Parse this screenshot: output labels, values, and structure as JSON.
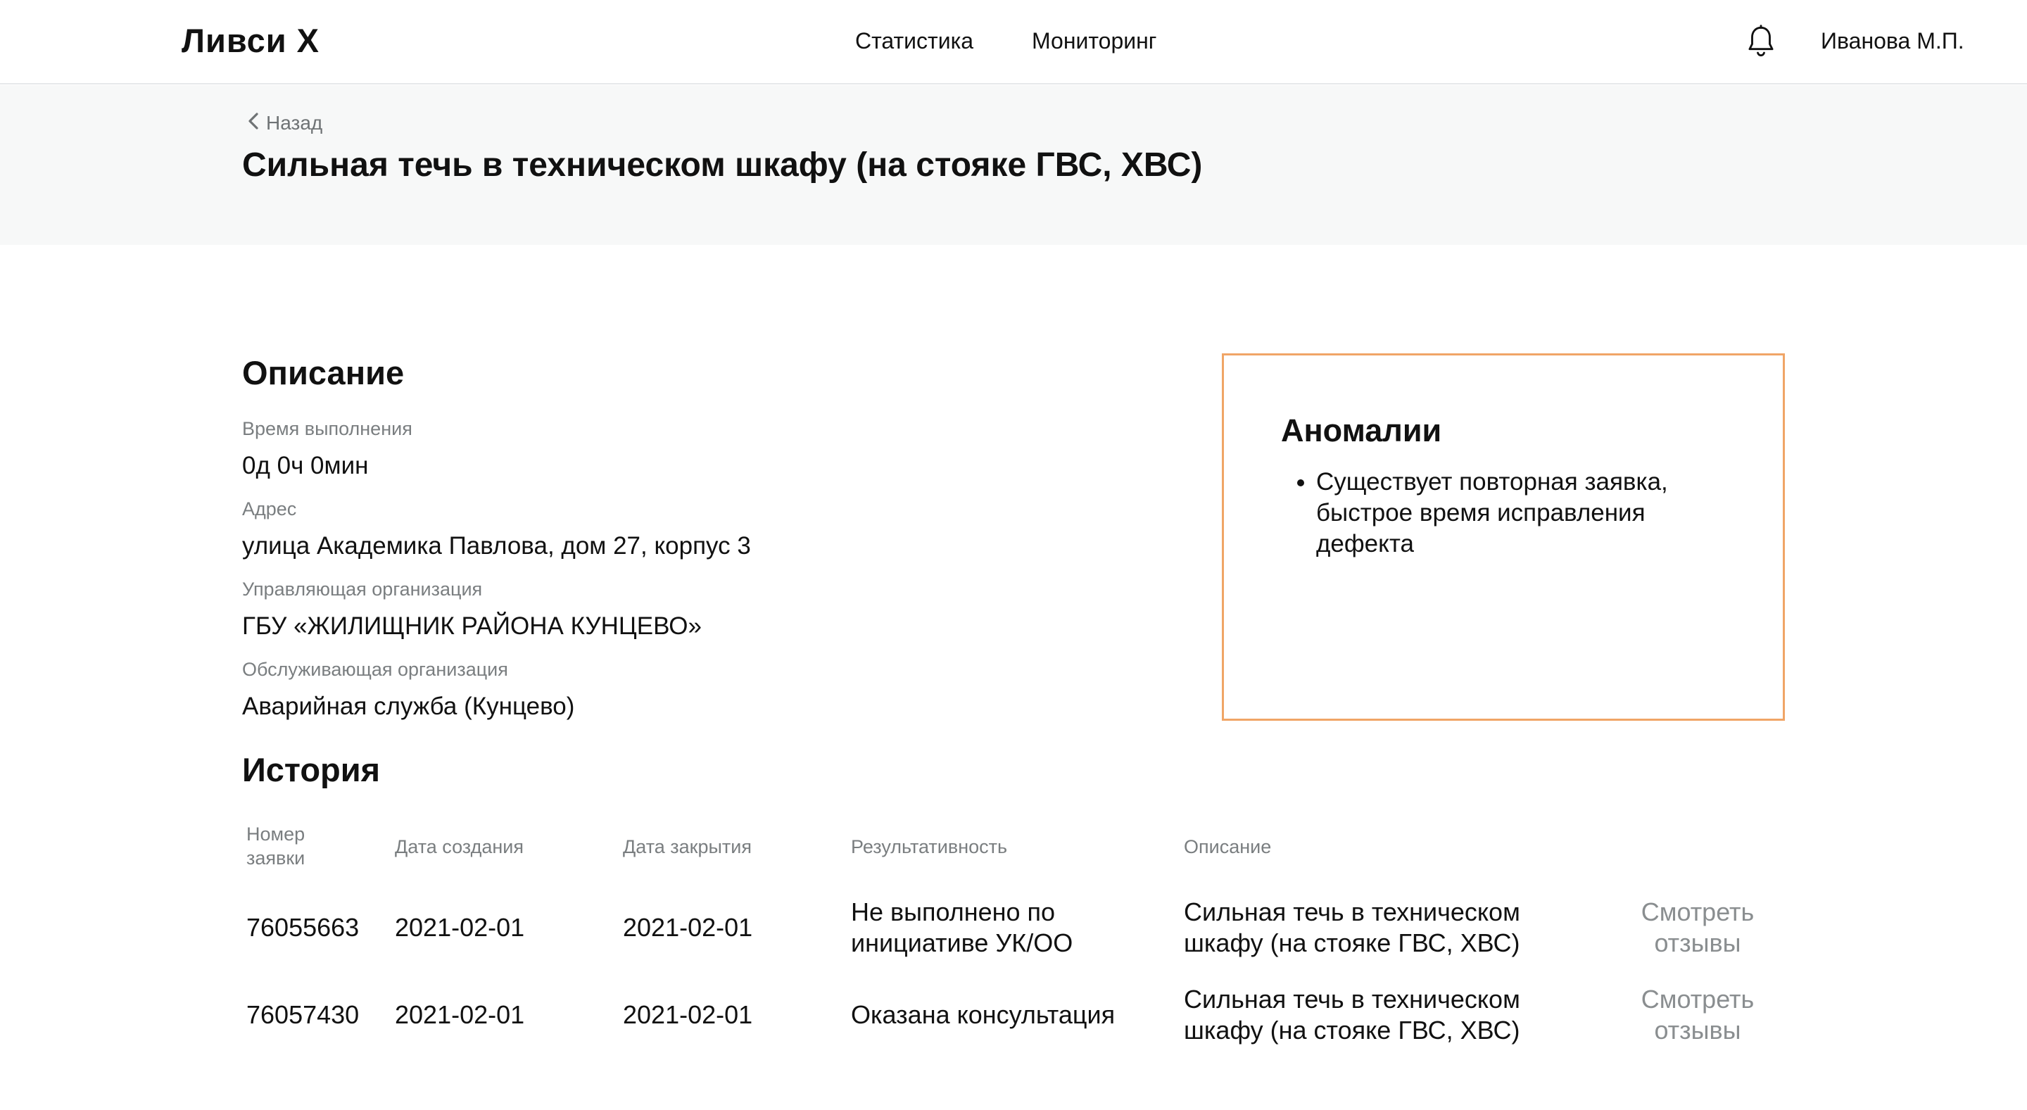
{
  "header": {
    "logo": "Ливси X",
    "nav": [
      "Статистика",
      "Мониторинг"
    ],
    "user": "Иванова М.П."
  },
  "page": {
    "back_label": "Назад",
    "title": "Сильная течь в техническом шкафу (на стояке ГВС, ХВС)"
  },
  "description": {
    "title": "Описание",
    "fields": [
      {
        "label": "Время выполнения",
        "value": "0д 0ч 0мин"
      },
      {
        "label": "Адрес",
        "value": "улица Академика Павлова, дом 27, корпус 3"
      },
      {
        "label": "Управляющая организация",
        "value": "ГБУ «ЖИЛИЩНИК РАЙОНА КУНЦЕВО»"
      },
      {
        "label": "Обслуживающая организация",
        "value": "Аварийная служба (Кунцево)"
      }
    ]
  },
  "anomalies": {
    "title": "Аномалии",
    "items": [
      "Существует повторная заявка, быстрое время исправления дефекта"
    ]
  },
  "history": {
    "title": "История",
    "columns": [
      "Номер заявки",
      "Дата создания",
      "Дата закрытия",
      "Результативность",
      "Описание"
    ],
    "rows": [
      {
        "number": "76055663",
        "created": "2021-02-01",
        "closed": "2021-02-01",
        "result": "Не выполнено по инициативе УК/ОО",
        "description": "Сильная течь в техническом шкафу (на стояке ГВС, ХВС)",
        "action": "Смотреть отзывы"
      },
      {
        "number": "76057430",
        "created": "2021-02-01",
        "closed": "2021-02-01",
        "result": "Оказана консультация",
        "description": "Сильная течь в техническом шкафу (на стояке ГВС, ХВС)",
        "action": "Смотреть отзывы"
      }
    ]
  },
  "colors": {
    "accent_border": "#f0a566",
    "band_background": "#f7f8f8",
    "muted_text": "#7a7e80"
  },
  "icons": [
    "bell-icon",
    "chevron-left-icon"
  ]
}
